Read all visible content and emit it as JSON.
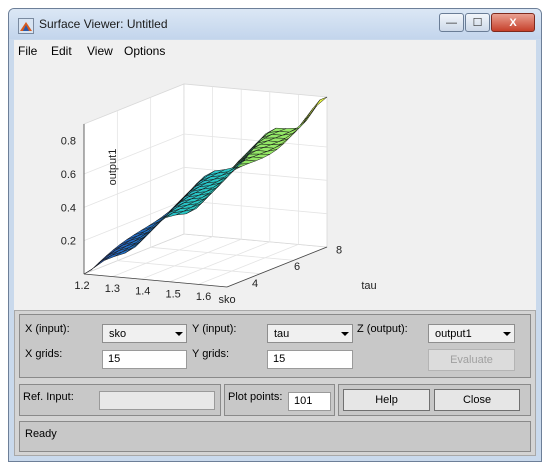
{
  "window": {
    "title": "Surface Viewer: Untitled",
    "controls": {
      "minimize": "—",
      "maximize": "☐",
      "close": "X"
    }
  },
  "menu": [
    "File",
    "Edit",
    "View",
    "Options"
  ],
  "plot": {
    "zlabel": "output1",
    "xlabel": "sko",
    "ylabel": "tau",
    "zticks": [
      "0.2",
      "0.4",
      "0.6",
      "0.8"
    ],
    "xticks": [
      "1.2",
      "1.3",
      "1.4",
      "1.5",
      "1.6"
    ],
    "yticks": [
      "4",
      "6",
      "8"
    ],
    "colormap": [
      "#2a3ea8",
      "#1f8fd8",
      "#2bd0c0",
      "#8ee86a",
      "#f2f03a"
    ]
  },
  "controls": {
    "x_input_label": "X (input):",
    "x_input_value": "sko",
    "y_input_label": "Y (input):",
    "y_input_value": "tau",
    "z_output_label": "Z (output):",
    "z_output_value": "output1",
    "x_grids_label": "X grids:",
    "x_grids_value": "15",
    "y_grids_label": "Y grids:",
    "y_grids_value": "15",
    "evaluate_label": "Evaluate",
    "ref_input_label": "Ref. Input:",
    "ref_input_value": "",
    "plot_points_label": "Plot points:",
    "plot_points_value": "101",
    "help_label": "Help",
    "close_label": "Close"
  },
  "status": {
    "text": "Ready"
  }
}
